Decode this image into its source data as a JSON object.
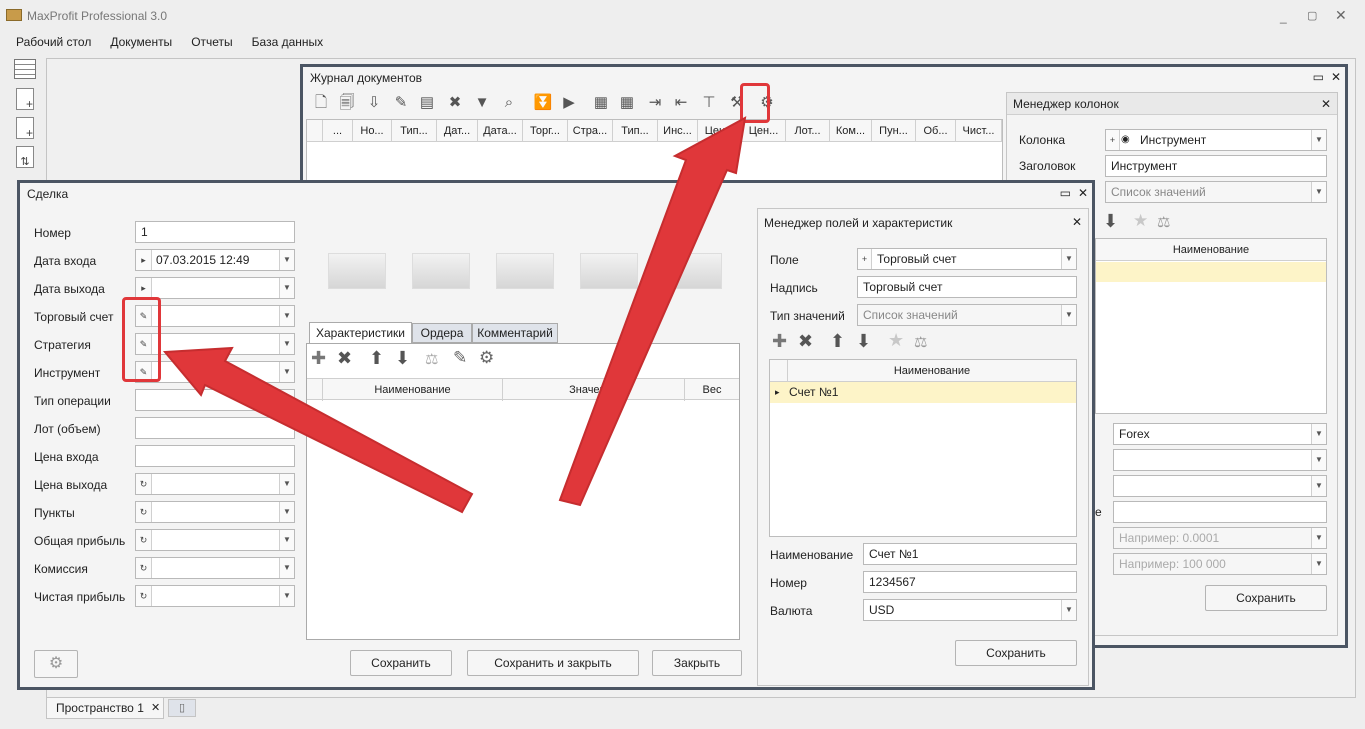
{
  "app": {
    "title": "MaxProfit Professional 3.0"
  },
  "menu": [
    "Рабочий стол",
    "Документы",
    "Отчеты",
    "База данных"
  ],
  "journal": {
    "title": "Журнал документов",
    "columns": [
      "...",
      "Но...",
      "Тип...",
      "Дат...",
      "Дата...",
      "Торг...",
      "Стра...",
      "Тип...",
      "Инс...",
      "Цен...",
      "Цен...",
      "Лот...",
      "Ком...",
      "Пун...",
      "Об...",
      "Чист..."
    ]
  },
  "column_manager": {
    "title": "Менеджер колонок",
    "kolonka_label": "Колонка",
    "kolonka_value": "Инструмент",
    "header_label": "Заголовок",
    "header_value": "Инструмент",
    "type_value": "Список значений",
    "grid_header": "Наименование",
    "forex_value": "Forex",
    "partial_label": "е",
    "placeholder1": "Например: 0.0001",
    "placeholder2": "Например: 100 000",
    "save_label": "Сохранить"
  },
  "deal": {
    "title": "Сделка",
    "fields": [
      {
        "label": "Номер",
        "value": "1"
      },
      {
        "label": "Дата входа",
        "value": "07.03.2015 12:49"
      },
      {
        "label": "Дата выхода",
        "value": ""
      },
      {
        "label": "Торговый счет",
        "value": ""
      },
      {
        "label": "Стратегия",
        "value": ""
      },
      {
        "label": "Инструмент",
        "value": ""
      },
      {
        "label": "Тип операции",
        "value": ""
      },
      {
        "label": "Лот (объем)",
        "value": ""
      },
      {
        "label": "Цена входа",
        "value": ""
      },
      {
        "label": "Цена выхода",
        "value": ""
      },
      {
        "label": "Пункты",
        "value": ""
      },
      {
        "label": "Общая прибыль",
        "value": ""
      },
      {
        "label": "Комиссия",
        "value": ""
      },
      {
        "label": "Чистая прибыль",
        "value": ""
      }
    ],
    "tabs": [
      "Характеристики",
      "Ордера",
      "Комментарий"
    ],
    "grid_cols": [
      "Наименование",
      "Значение",
      "Вес"
    ],
    "buttons": {
      "save": "Сохранить",
      "save_close": "Сохранить и закрыть",
      "close": "Закрыть"
    }
  },
  "field_manager": {
    "title": "Менеджер полей и характеристик",
    "pole_label": "Поле",
    "pole_value": "Торговый счет",
    "nadpis_label": "Надпись",
    "nadpis_value": "Торговый счет",
    "type_label": "Тип значений",
    "type_value": "Список значений",
    "grid_header": "Наименование",
    "row_value": "Счет №1",
    "name_label": "Наименование",
    "name_value": "Счет №1",
    "number_label": "Номер",
    "number_value": "1234567",
    "currency_label": "Валюта",
    "currency_value": "USD",
    "save_label": "Сохранить"
  },
  "workspace": {
    "tab": "Пространство 1"
  },
  "colors": {
    "arrow": "#e0373a",
    "frame": "#4b5563",
    "selected_row": "#fdf4c8"
  }
}
